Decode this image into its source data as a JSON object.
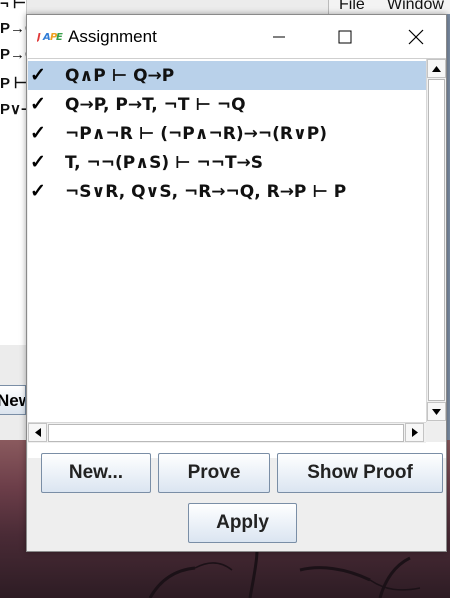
{
  "background_app": {
    "left_lines": [
      "P→Q",
      "P→Q",
      "P ⊢",
      "P∨¬"
    ],
    "top_line": "¬ ⊢ T",
    "new_label": "New",
    "menu": [
      "File",
      "Window"
    ]
  },
  "dialog": {
    "title": "Assignment",
    "logo_text": "JAPE",
    "controls": {
      "minimize": "minimize-icon",
      "maximize": "maximize-icon",
      "close": "close-icon"
    },
    "check_mark": "✓",
    "formulas": [
      {
        "text": "Q∧P ⊢ Q→P",
        "checked": true,
        "selected": true
      },
      {
        "text": "Q→P, P→T, ¬T ⊢ ¬Q",
        "checked": true,
        "selected": false
      },
      {
        "text": "¬P∧¬R ⊢ (¬P∧¬R)→¬(R∨P)",
        "checked": true,
        "selected": false
      },
      {
        "text": "T, ¬¬(P∧S) ⊢ ¬¬T→S",
        "checked": true,
        "selected": false
      },
      {
        "text": "¬S∨R, Q∨S, ¬R→¬Q, R→P ⊢ P",
        "checked": true,
        "selected": false
      }
    ],
    "buttons": {
      "new": "New...",
      "prove": "Prove",
      "show_proof": "Show Proof",
      "apply": "Apply"
    },
    "selection_color": "#b9d1ea"
  }
}
